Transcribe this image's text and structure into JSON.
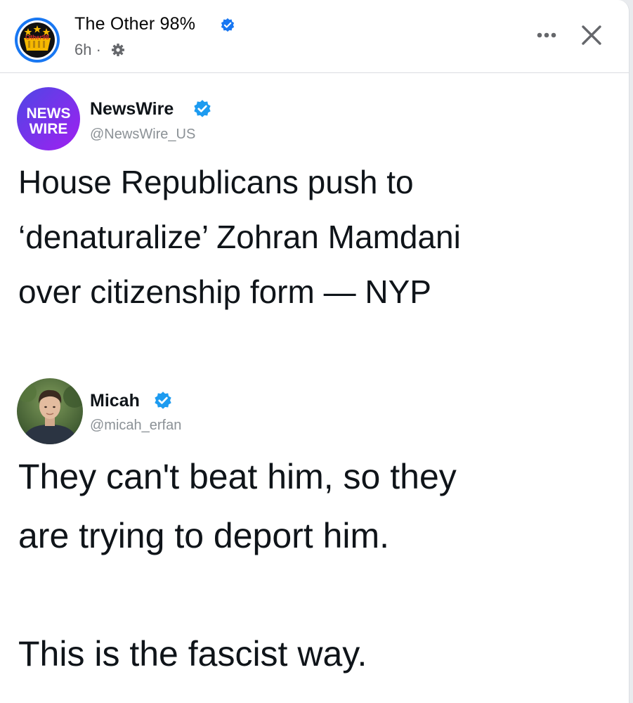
{
  "post": {
    "page_name": "The Other 98%",
    "page_avatar_text": "Other98",
    "timestamp": "6h",
    "separator": "·",
    "audience_icon": "gear-icon",
    "more_icon": "more-dots-icon",
    "close_icon": "close-icon"
  },
  "tweets": [
    {
      "avatar_lines": [
        "NEWS",
        "WIRE"
      ],
      "name": "NewsWire",
      "handle": "@NewsWire_US",
      "verified": true,
      "text_lines": [
        "House Republicans push to",
        "‘denaturalize’ Zohran Mamdani",
        "over citizenship form — NYP"
      ]
    },
    {
      "name": "Micah",
      "handle": "@micah_erfan",
      "verified": true,
      "text_lines": [
        "They can't beat him, so they",
        "are trying to deport him.",
        "",
        "This is the fascist way."
      ]
    }
  ],
  "colors": {
    "verified_blue": "#1d9bf0",
    "newswire_gradient_start": "#4f46e5",
    "newswire_gradient_end": "#9b30ff",
    "other98_gold": "#f5b800"
  }
}
